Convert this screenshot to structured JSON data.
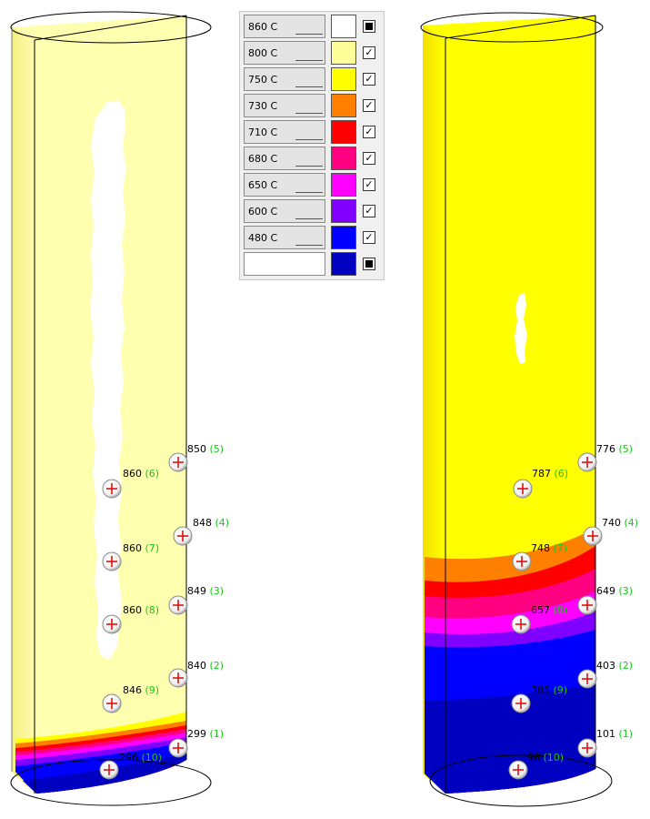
{
  "legend": [
    {
      "label": "860 C",
      "color": "#ffffff",
      "check": "solid"
    },
    {
      "label": "800 C",
      "color": "#ffff99",
      "check": "check"
    },
    {
      "label": "750 C",
      "color": "#ffff00",
      "check": "check"
    },
    {
      "label": "730 C",
      "color": "#ff8000",
      "check": "check"
    },
    {
      "label": "710 C",
      "color": "#ff0000",
      "check": "check"
    },
    {
      "label": "680 C",
      "color": "#ff0080",
      "check": "check"
    },
    {
      "label": "650 C",
      "color": "#ff00ff",
      "check": "check"
    },
    {
      "label": "600 C",
      "color": "#8000ff",
      "check": "check"
    },
    {
      "label": "480 C",
      "color": "#0000ff",
      "check": "check"
    },
    {
      "label": "",
      "color": "#0000c0",
      "check": "solid"
    }
  ],
  "left_probes": [
    {
      "value": "850",
      "index": "(5)"
    },
    {
      "value": "860",
      "index": "(6)"
    },
    {
      "value": "848",
      "index": "(4)"
    },
    {
      "value": "860",
      "index": "(7)"
    },
    {
      "value": "849",
      "index": "(3)"
    },
    {
      "value": "860",
      "index": "(8)"
    },
    {
      "value": "840",
      "index": "(2)"
    },
    {
      "value": "846",
      "index": "(9)"
    },
    {
      "value": "299",
      "index": "(1)"
    },
    {
      "value": "296",
      "index": "(10)"
    }
  ],
  "right_probes": [
    {
      "value": "776",
      "index": "(5)"
    },
    {
      "value": "787",
      "index": "(6)"
    },
    {
      "value": "740",
      "index": "(4)"
    },
    {
      "value": "748",
      "index": "(7)"
    },
    {
      "value": "649",
      "index": "(3)"
    },
    {
      "value": "657",
      "index": "(8)"
    },
    {
      "value": "403",
      "index": "(2)"
    },
    {
      "value": "385",
      "index": "(9)"
    },
    {
      "value": "101",
      "index": "(1)"
    },
    {
      "value": "96",
      "index": "(10)"
    }
  ]
}
